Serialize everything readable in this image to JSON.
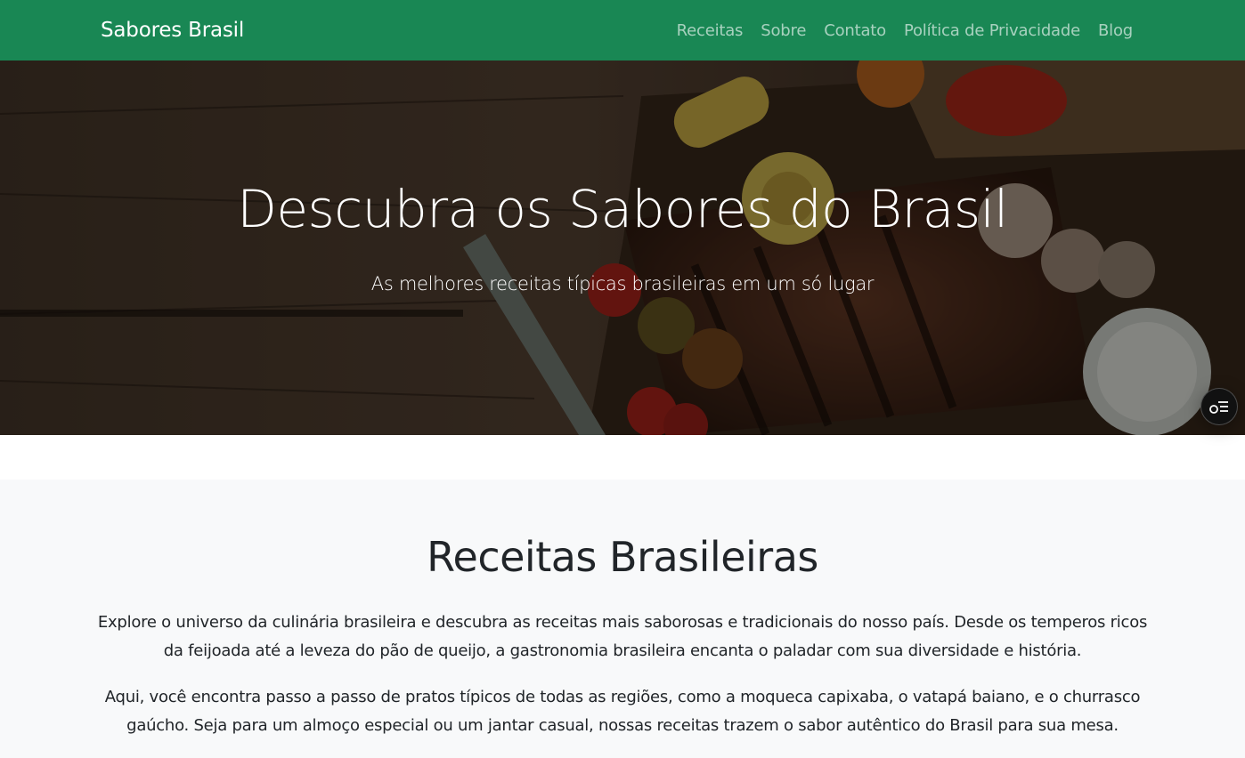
{
  "navbar": {
    "brand": "Sabores Brasil",
    "links": [
      "Receitas",
      "Sobre",
      "Contato",
      "Política de Privacidade",
      "Blog"
    ],
    "bg_color": "#198754"
  },
  "hero": {
    "title": "Descubra os Sabores do Brasil",
    "subtitle": "As melhores receitas típicas brasileiras em um só lugar",
    "background": "grilled steak, corn, peppers, mushrooms and tomatoes on a dark wooden table"
  },
  "floating_button": {
    "icon": "accessibility-menu-icon"
  },
  "recipes_section": {
    "heading": "Receitas Brasileiras",
    "paragraphs": [
      "Explore o universo da culinária brasileira e descubra as receitas mais saborosas e tradicionais do nosso país. Desde os temperos ricos da feijoada até a leveza do pão de queijo, a gastronomia brasileira encanta o paladar com sua diversidade e história.",
      "Aqui, você encontra passo a passo de pratos típicos de todas as regiões, como a moqueca capixaba, o vatapá baiano, e o churrasco gaúcho. Seja para um almoço especial ou um jantar casual, nossas receitas trazem o sabor autêntico do Brasil para sua mesa."
    ]
  }
}
